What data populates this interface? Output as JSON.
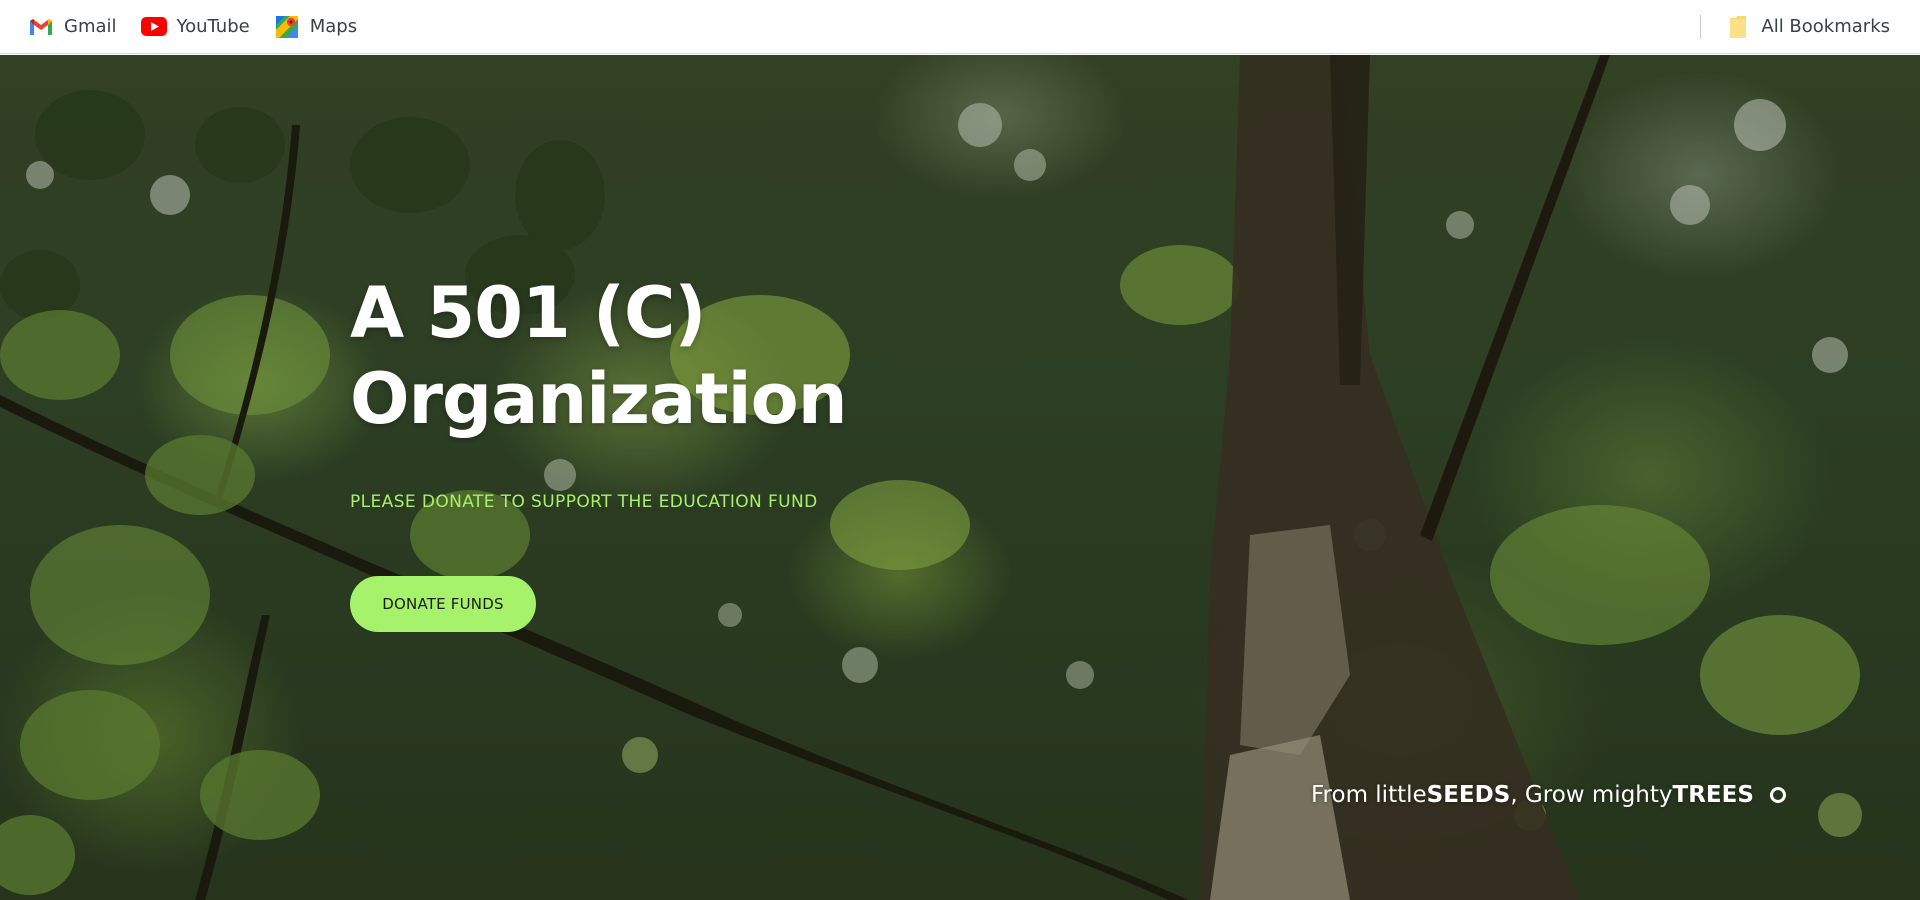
{
  "bookmarks": {
    "items": [
      {
        "label": "Gmail",
        "icon": "gmail-icon"
      },
      {
        "label": "YouTube",
        "icon": "youtube-icon"
      },
      {
        "label": "Maps",
        "icon": "maps-icon"
      }
    ],
    "all_bookmarks": {
      "label": "All Bookmarks",
      "icon": "folder-icon"
    }
  },
  "hero": {
    "title_line1": "A 501 (C)",
    "title_line2": "Organization",
    "subtitle": "PLEASE DONATE TO SUPPORT THE EDUCATION FUND",
    "donate_button": "DONATE FUNDS",
    "tagline": {
      "part1": "From little ",
      "part2": "SEEDS",
      "part3": ", Grow mighty ",
      "part4": "TREES"
    }
  },
  "colors": {
    "accent": "#a6f26a",
    "title": "#ffffff",
    "bookmark_text": "#3c4043"
  }
}
